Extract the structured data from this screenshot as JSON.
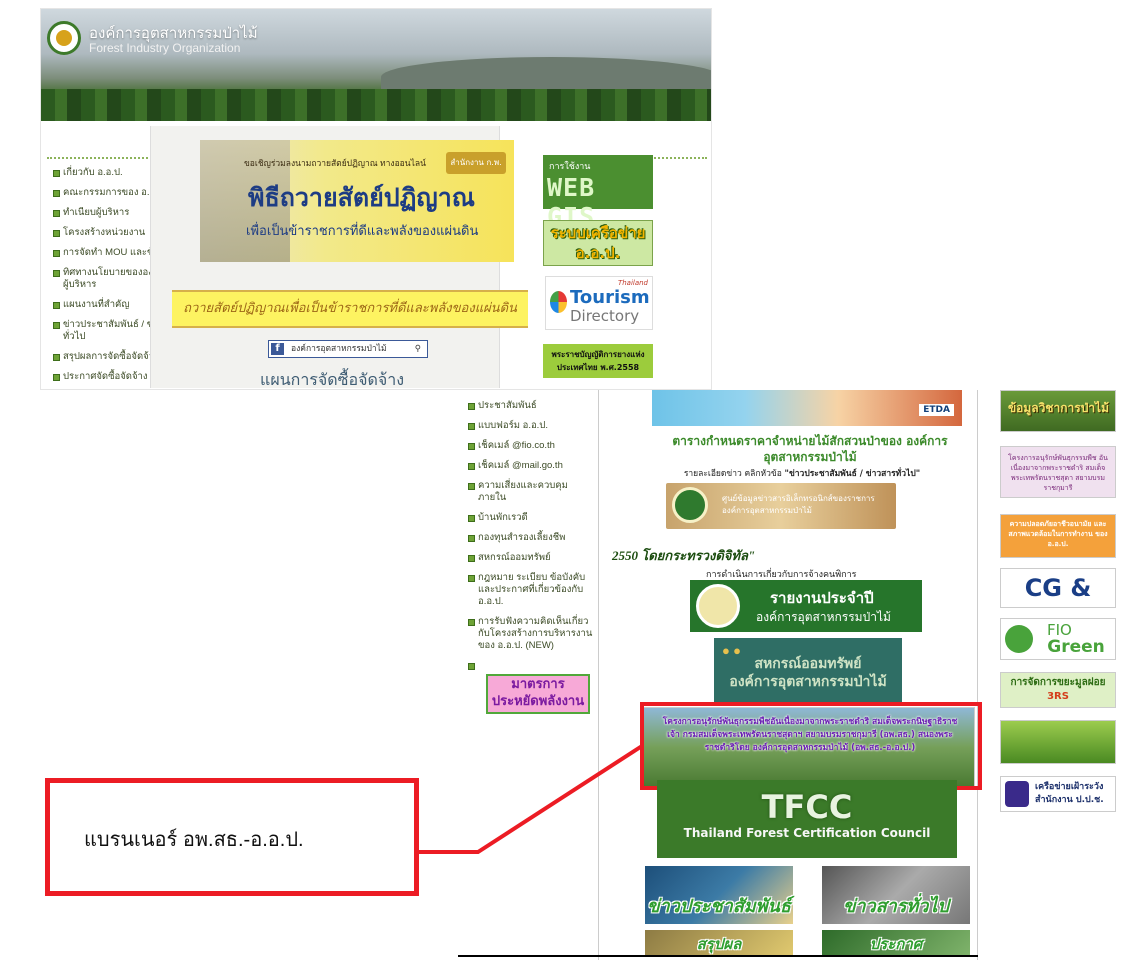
{
  "header": {
    "org_name_th": "องค์การอุตสาหกรรมป่าไม้",
    "org_name_en": "Forest Industry Organization"
  },
  "left_nav": {
    "items": [
      "เกี่ยวกับ อ.อ.ป.",
      "คณะกรรมการของ อ.อ.ป.",
      "ทำเนียบผู้บริหาร",
      "โครงสร้างหน่วยงาน",
      "การจัดทำ MOU และข้อตกลง",
      "ทิศทางนโยบายขององค์กรโดยผู้บริหาร",
      "แผนงานที่สำคัญ",
      "ข่าวประชาสัมพันธ์ / ข่าวสารทั่วไป",
      "สรุปผลการจัดซื้อจัดจ้าง",
      "ประกาศจัดซื้อจัดจ้าง"
    ]
  },
  "left_nav2": {
    "items": [
      "ประชาสัมพันธ์",
      "แบบฟอร์ม อ.อ.ป.",
      "เช็คเมล์ @fio.co.th",
      "เช็คเมล์ @mail.go.th",
      "ความเสี่ยงและควบคุมภายใน",
      "บ้านพักเรวดี",
      "กองทุนสำรองเลี้ยงชีพ",
      "สหกรณ์ออมทรัพย์",
      "กฎหมาย ระเบียบ ข้อบังคับ และประกาศที่เกี่ยวข้องกับ อ.อ.ป.",
      "การรับฟังความคิดเห็นเกี่ยวกับโครงสร้างการบริหารงานของ อ.อ.ป. (NEW)",
      ""
    ],
    "energy_banner": "มาตรการประหยัดพลังงาน"
  },
  "main": {
    "oath_banner": {
      "invite": "ขอเชิญร่วมลงนามถวายสัตย์ปฏิญาณ ทางออนไลน์",
      "agency": "สำนักงาน ก.พ.",
      "title": "พิธีถวายสัตย์ปฏิญาณ",
      "subtitle": "เพื่อเป็นข้าราชการที่ดีและพลังของแผ่นดิน"
    },
    "oath_strip": "ถวายสัตย์ปฏิญาณเพื่อเป็นข้าราชการที่ดีและพลังของแผ่นดิน",
    "facebook_search": "องค์การอุตสาหกรรมป่าไม้",
    "procurement_heading": "แผนการจัดซื้อจัดจ้าง",
    "price_table_title": "ตารางกำหนดราคาจำหน่ายไม้สักสวนป่าของ องค์การอุตสาหกรรมป่าไม้",
    "price_detail_prefix": "รายละเอียดข่าว คลิกหัวข้อ ",
    "price_detail_link": "\"ข่าวประชาสัมพันธ์ / ข่าวสารทั่วไป\"",
    "cert_banner": "ศูนย์ข้อมูลข่าวสารอิเล็กทรอนิกส์ของราชการ องค์การอุตสาหกรรมป่าไม้",
    "year_text": "2550 โดยกระทรวงดิจิทัล\"",
    "employment_text": "การดำเนินการเกี่ยวกับการจ้างคนพิการ",
    "annual_report_line1": "รายงานประจำปี",
    "annual_report_line2": "องค์การอุตสาหกรรมป่าไม้",
    "coop_line1": "สหกรณ์ออมทรัพย์",
    "coop_line2": "องค์การอุตสาหกรรมป่าไม้",
    "fio_banner": "โครงการอนุรักษ์พันธุกรรมพืชอันเนื่องมาจากพระราชดำริ สมเด็จพระกนิษฐาธิราชเจ้า กรมสมเด็จพระเทพรัตนราชสุดาฯ สยามบรมราชกุมารี (อพ.สธ.) สนองพระราชดำริโดย องค์การอุตสาหกรรมป่าไม้ (อพ.สธ.-อ.อ.ป.)",
    "tfcc_title": "TFCC",
    "tfcc_sub": "Thailand Forest Certification Council",
    "news_pr": "ข่าวประชาสัมพันธ์",
    "news_general": "ข่าวสารทั่วไป",
    "summary": "สรุปผล",
    "announce": "ประกาศ",
    "etda": "ETDA"
  },
  "right_side": {
    "webgis_top": "การใช้งาน",
    "webgis": "WEB GIS",
    "network": "ระบบเครือข่าย อ.อ.ป.",
    "tourism_th": "Thailand",
    "tourism1": "Tourism",
    "tourism2": "Directory",
    "law": "พระราชบัญญัติการยางแห่งประเทศไทย พ.ศ.2558"
  },
  "right_side2": {
    "info": "ข้อมูลวิชาการป่าไม้",
    "project": "โครงการอนุรักษ์พันธุกรรมพืช อันเนื่องมาจากพระราชดำริ สมเด็จพระเทพรัตนราชสุดา สยามบรมราชกุมารี",
    "safety": "ความปลอดภัยอาชีวอนามัย และสภาพแวดล้อมในการทำงาน ของ อ.อ.ป.",
    "cgcsr": "CG & CSR",
    "green1": "FIO",
    "green2": "Green IT",
    "waste": "การจัดการขยะมูลฝอย",
    "waste2": "3RS",
    "forest_lit": "",
    "nacc": "เครือข่ายเฝ้าระวัง สำนักงาน ป.ป.ช."
  },
  "callout": {
    "label": "แบรนเนอร์ อพ.สธ.-อ.อ.ป."
  },
  "colors": {
    "highlight": "#ec1c24",
    "nav_green": "#6ea336",
    "fb_blue": "#3b5998"
  }
}
